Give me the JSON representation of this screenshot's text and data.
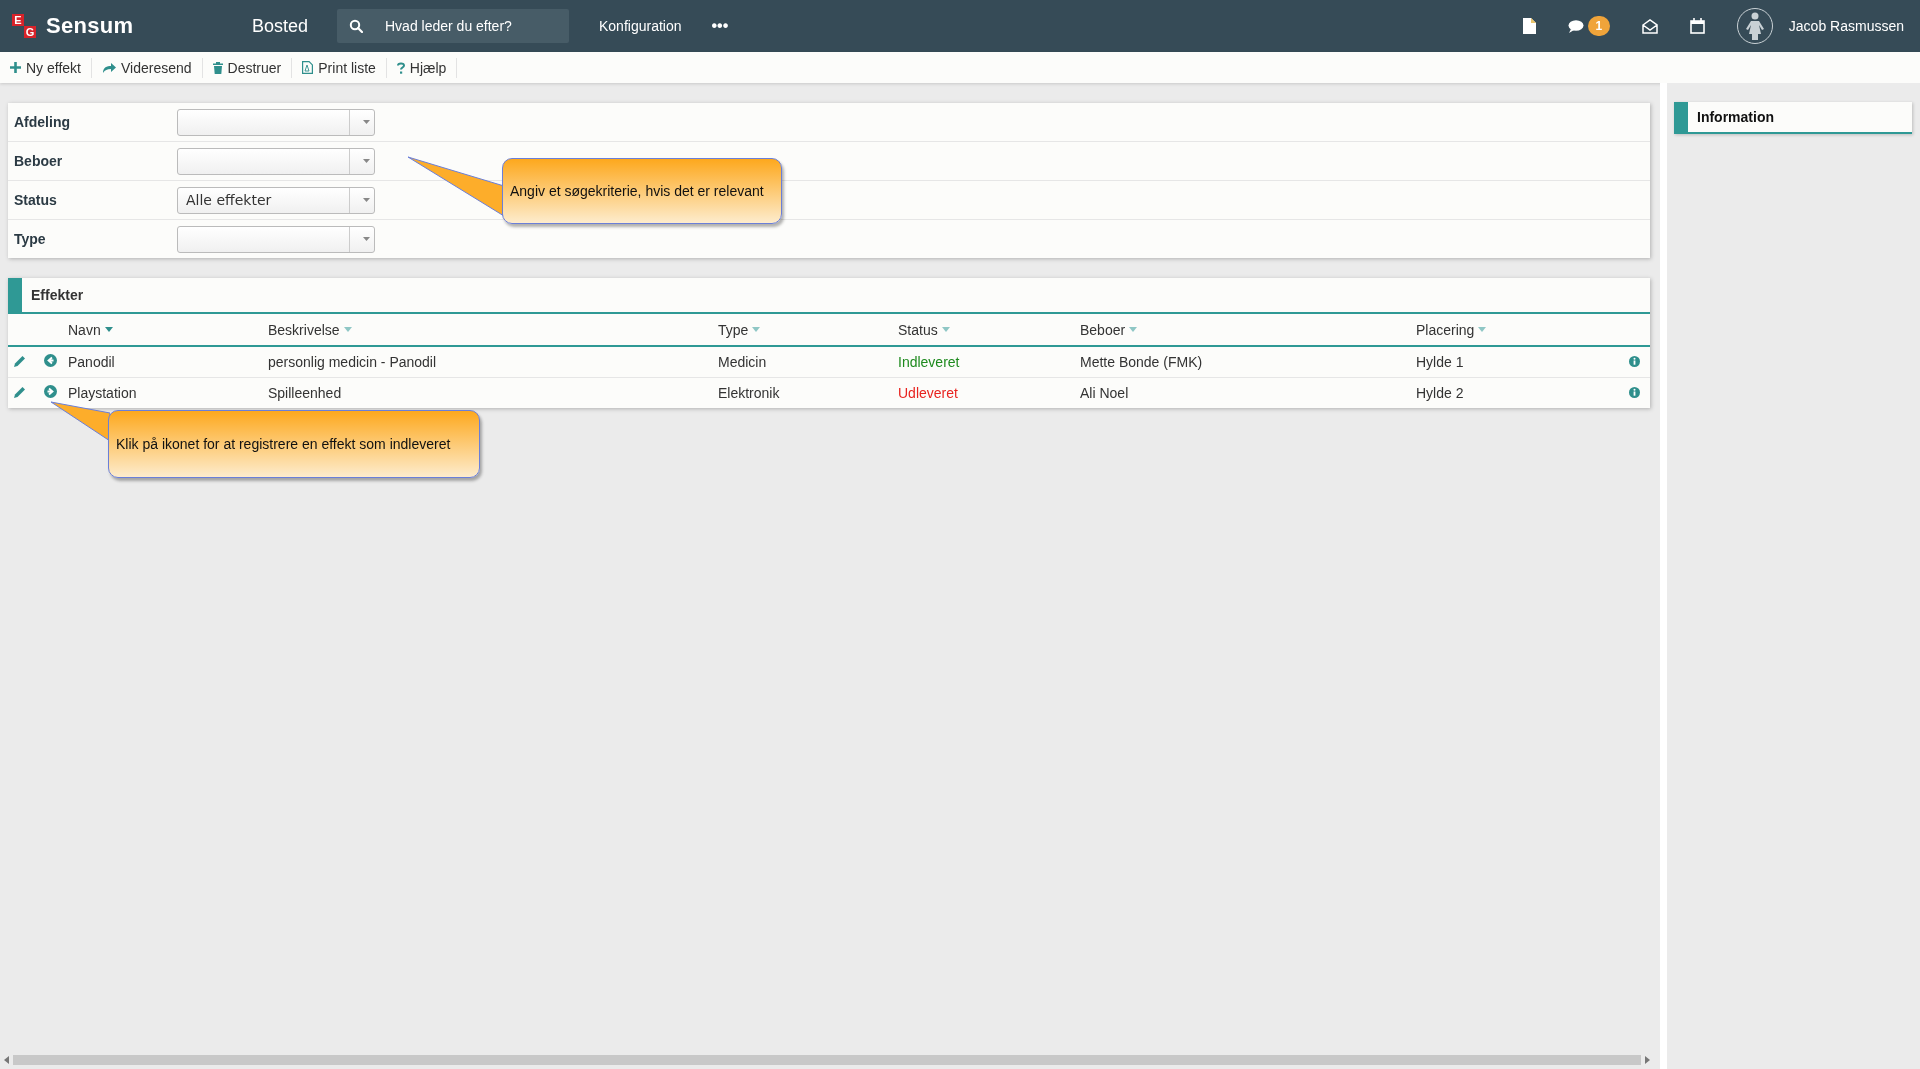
{
  "topbar": {
    "logo_letters": [
      "E",
      "G"
    ],
    "app_name": "Sensum",
    "context": "Bosted",
    "search": {
      "placeholder": "Hvad leder du efter?"
    },
    "menu": [
      "Konfiguration"
    ],
    "more": "•••",
    "chat_badge": "1",
    "user": "Jacob Rasmussen"
  },
  "toolbar": [
    {
      "kind": "plus",
      "label": "Ny effekt"
    },
    {
      "kind": "forward",
      "label": "Videresend"
    },
    {
      "kind": "trash",
      "label": "Destruer"
    },
    {
      "kind": "pdf",
      "label": "Print liste"
    },
    {
      "kind": "help",
      "label": "Hjælp"
    }
  ],
  "filters": [
    {
      "label": "Afdeling"
    },
    {
      "label": "Beboer"
    },
    {
      "label": "Status",
      "value": "Alle effekter"
    },
    {
      "label": "Type"
    }
  ],
  "effects": {
    "title": "Effekter",
    "columns": [
      {
        "label": "Navn",
        "sorted": true
      },
      {
        "label": "Beskrivelse",
        "sorted": false
      },
      {
        "label": "Type",
        "sorted": false
      },
      {
        "label": "Status",
        "sorted": false
      },
      {
        "label": "Beboer",
        "sorted": false
      },
      {
        "label": "Placering",
        "sorted": false
      }
    ],
    "rows": [
      {
        "kind": "return",
        "cells": [
          "Panodil",
          "personlig medicin - Panodil",
          "Medicin"
        ],
        "status": {
          "text": "Indleveret",
          "color": "#1e8a1e"
        },
        "beboer": "Mette Bonde (FMK)",
        "placering": "Hylde 1"
      },
      {
        "kind": "issue",
        "cells": [
          "Playstation",
          "Spilleenhed",
          "Elektronik"
        ],
        "status": {
          "text": "Udleveret",
          "color": "#e8231f"
        },
        "beboer": "Ali Noel",
        "placering": "Hylde 2"
      }
    ]
  },
  "info_panel": {
    "title": "Information"
  },
  "callouts": [
    {
      "text": "Angiv et søgekriterie, hvis det er relevant"
    },
    {
      "text": "Klik på ikonet for at registrere en effekt som indleveret"
    }
  ]
}
